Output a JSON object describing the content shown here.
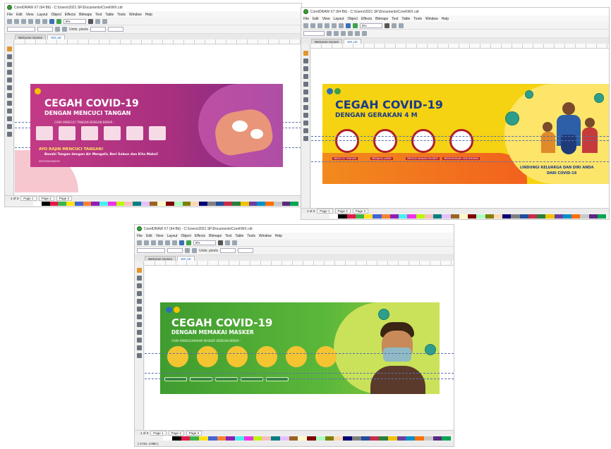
{
  "screens": [
    {
      "title": "CorelDRAW X7 (64 Bit) - C:\\Users\\2021 SF\\Documents\\Corel\\WX.cdr",
      "menu": [
        "File",
        "Edit",
        "View",
        "Layout",
        "Object",
        "Effects",
        "Bitmaps",
        "Text",
        "Table",
        "Tools",
        "Window",
        "Help"
      ],
      "zoom": "8%",
      "units_label": "Units: pixels",
      "doc_tabs": [
        "Welcome Screen",
        "WX.cdr"
      ],
      "pages": [
        "Page 1",
        "Page 2",
        "Page 3"
      ],
      "page_counter": "1 of 3",
      "banner": {
        "title": "CEGAH COVID-19",
        "subtitle": "DENGAN MENCUCI TANGAN",
        "steps_caption": "CARA MENCUCI TANGAN DENGAN BENAR :",
        "cta_1": "AYO RAJIN MENCUCI TANGAN!",
        "cta_2": "Basahi Tangan dengan Air Mengalir, Beri Sabun dan Kita Maksi!",
        "footer": "INFORMASIBIDPS"
      }
    },
    {
      "title": "CorelDRAW X7 (64 Bit) - C:\\Users\\2021 SF\\Documents\\Corel\\WX.cdr",
      "menu": [
        "File",
        "Edit",
        "View",
        "Layout",
        "Object",
        "Effects",
        "Bitmaps",
        "Text",
        "Table",
        "Tools",
        "Window",
        "Help"
      ],
      "zoom": "8%",
      "doc_tabs": [
        "Welcome Screen",
        "WX.cdr"
      ],
      "pages": [
        "Page 1",
        "Page 2",
        "Page 3"
      ],
      "page_counter": "1 of 3",
      "banner": {
        "title": "CEGAH COVID-19",
        "subtitle": "DENGAN GERAKAN 4 M",
        "items": [
          "MENCUCI TANGAN",
          "MENJAGA JARAK",
          "MENGGUNAKAN MASKER",
          "MENGHINDARI KERUMUNAN"
        ],
        "footer_1": "LINDUNGI KELUARGA DAN DIRI ANDA",
        "footer_2": "DARI COVID-19"
      }
    },
    {
      "title": "CorelDRAW X7 (64 Bit) - C:\\Users\\2021 SF\\Documents\\Corel\\WX.cdr",
      "menu": [
        "File",
        "Edit",
        "View",
        "Layout",
        "Object",
        "Effects",
        "Bitmaps",
        "Text",
        "Table",
        "Tools",
        "Window",
        "Help"
      ],
      "zoom": "8%",
      "units_label": "Units: pixels",
      "doc_tabs": [
        "Welcome Screen",
        "WX.cdr"
      ],
      "pages": [
        "Page 1",
        "Page 2",
        "Page 3"
      ],
      "page_counter": "1 of 3",
      "banner": {
        "title": "CEGAH COVID-19",
        "subtitle": "DENGAN MEMAKAI MASKER",
        "steps_caption": "CARA MENGGUNAKAN MASKER DENGAN BENAR :"
      },
      "status_coords": "(-1734, 4.980 )"
    }
  ],
  "palette_colors": [
    "#ffffff",
    "#000000",
    "#e6194b",
    "#3cb44b",
    "#ffe119",
    "#4363d8",
    "#f58231",
    "#911eb4",
    "#46f0f0",
    "#f032e6",
    "#bcf60c",
    "#fabebe",
    "#008080",
    "#e6beff",
    "#9a6324",
    "#fffac8",
    "#800000",
    "#aaffc3",
    "#808000",
    "#ffd8b1",
    "#000075",
    "#808080",
    "#1f4e9c",
    "#c72c48",
    "#2a7f3c",
    "#f2c200",
    "#6b3fa0",
    "#0091c9",
    "#ff6f00",
    "#c8c8c8",
    "#5a2a82",
    "#00a651"
  ],
  "colors": {
    "pink_banner": "#a8307f",
    "yellow_banner": "#f5d312",
    "green_banner": "#56b135"
  }
}
